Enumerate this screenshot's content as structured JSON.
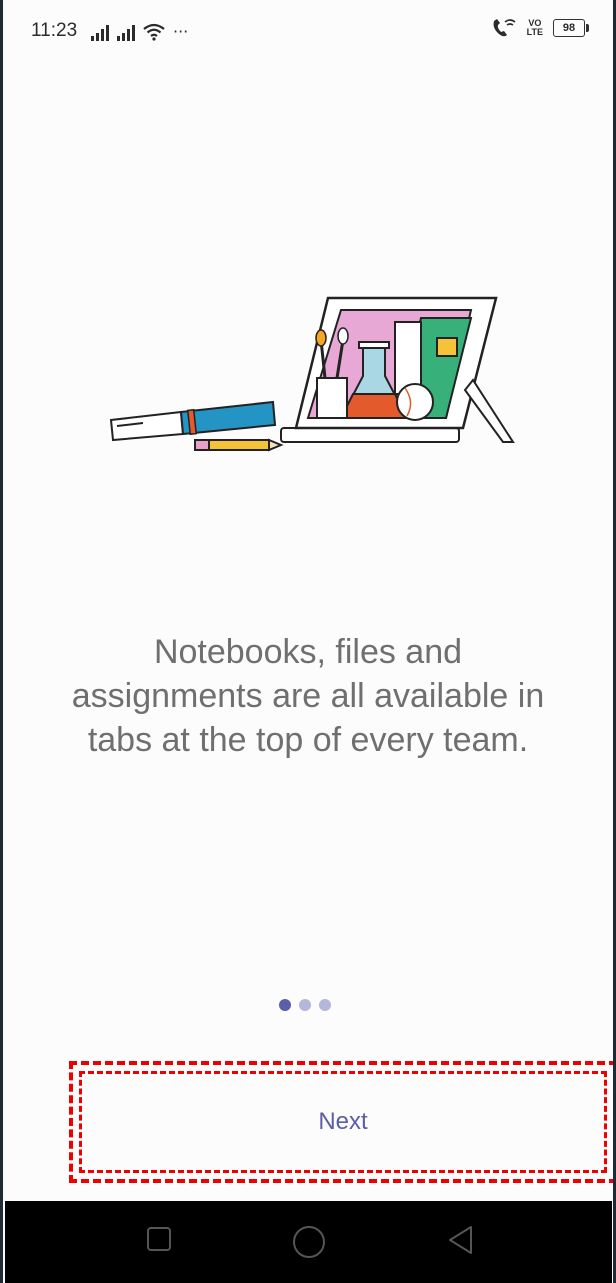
{
  "status_bar": {
    "time": "11:23",
    "left_icons": [
      "signal-icon",
      "signal-icon",
      "wifi-icon",
      "more-icon"
    ],
    "volte_top": "VO",
    "volte_bottom": "LTE",
    "battery": "98",
    "more": "···"
  },
  "onboarding": {
    "message": "Notebooks, files and assignments are all available in tabs at the top of every team.",
    "page_index": 1,
    "page_count": 3,
    "next_label": "Next"
  },
  "colors": {
    "accent": "#5c5ea6",
    "dot_active": "#5b5fa7",
    "dot_inactive": "#b4b7d9",
    "highlight": "#ee0000"
  },
  "nav": {
    "icons": [
      "recent-apps-icon",
      "home-icon",
      "back-icon"
    ]
  }
}
